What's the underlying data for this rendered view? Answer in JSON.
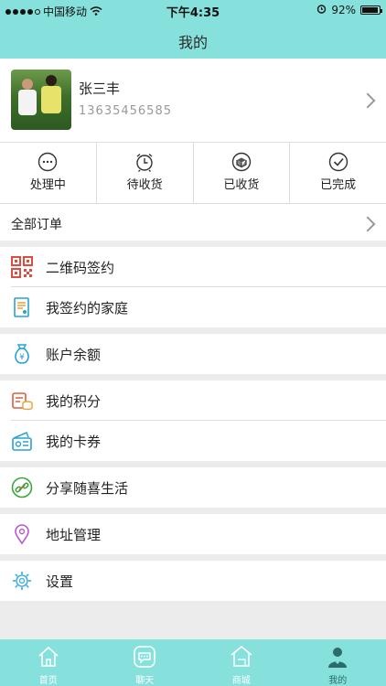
{
  "status_bar": {
    "carrier": "中国移动",
    "time": "下午4:35",
    "battery": "92%",
    "battery_level": 0.92
  },
  "header": {
    "title": "我的"
  },
  "profile": {
    "name": "张三丰",
    "phone": "13635456585"
  },
  "order_tabs": [
    {
      "label": "处理中",
      "icon": "ellipsis-circle-icon"
    },
    {
      "label": "待收货",
      "icon": "alarm-clock-icon"
    },
    {
      "label": "已收货",
      "icon": "box-received-icon"
    },
    {
      "label": "已完成",
      "icon": "check-circle-icon"
    }
  ],
  "all_orders": {
    "label": "全部订单"
  },
  "menu": [
    {
      "label": "二维码签约",
      "icon": "qrcode-icon",
      "color": "#e04a3f"
    },
    {
      "label": "我签约的家庭",
      "icon": "contract-icon",
      "color": "#e9a23b"
    },
    {
      "label": "账户余额",
      "icon": "money-bag-icon",
      "color": "#2aa1d3"
    },
    {
      "label": "我的积分",
      "icon": "points-coins-icon",
      "color": "#e05a3c"
    },
    {
      "label": "我的卡券",
      "icon": "coupon-icon",
      "color": "#2aa1d3"
    },
    {
      "label": "分享随喜生活",
      "icon": "share-link-icon",
      "color": "#3aa53d"
    },
    {
      "label": "地址管理",
      "icon": "location-pin-icon",
      "color": "#b35ad0"
    },
    {
      "label": "设置",
      "icon": "gear-icon",
      "color": "#4ab0e0"
    }
  ],
  "tab_bar": [
    {
      "label": "首页",
      "icon": "home-icon"
    },
    {
      "label": "聊天",
      "icon": "chat-icon"
    },
    {
      "label": "商城",
      "icon": "mall-icon"
    },
    {
      "label": "我的",
      "icon": "profile-icon",
      "active": true
    }
  ],
  "colors": {
    "theme": "#86e1dc",
    "active_tab_text": "#2b6b6a"
  }
}
